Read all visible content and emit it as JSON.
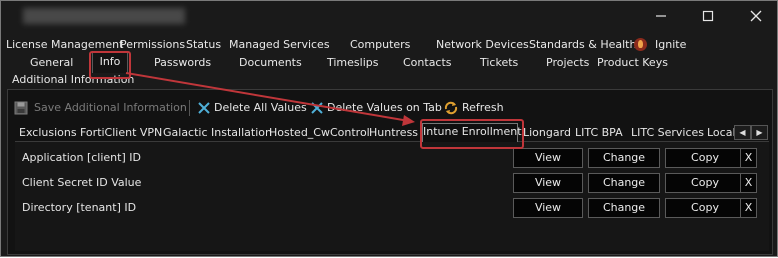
{
  "window": {
    "title": "",
    "minimize_glyph": "minimize-icon",
    "maximize_glyph": "maximize-icon",
    "close_glyph": "close-icon"
  },
  "top_tabs_row1": [
    {
      "label": "License Management"
    },
    {
      "label": "Permissions"
    },
    {
      "label": "Status"
    },
    {
      "label": "Managed Services"
    },
    {
      "label": "Computers"
    },
    {
      "label": "Network Devices"
    },
    {
      "label": "Standards & Health"
    },
    {
      "label": "Ignite"
    }
  ],
  "top_tabs_row2": [
    {
      "label": "General"
    },
    {
      "label": "Info",
      "selected": true
    },
    {
      "label": "Passwords"
    },
    {
      "label": "Documents"
    },
    {
      "label": "Timeslips"
    },
    {
      "label": "Contacts"
    },
    {
      "label": "Tickets"
    },
    {
      "label": "Projects"
    },
    {
      "label": "Product Keys"
    }
  ],
  "section_label": "Additional Information",
  "toolbar": {
    "save_label": "Save Additional Information",
    "delete_all_label": "Delete All Values",
    "delete_tab_label": "Delete Values on Tab",
    "refresh_label": "Refresh"
  },
  "sub_tabs": [
    {
      "label": "Exclusions"
    },
    {
      "label": "FortiClient VPN"
    },
    {
      "label": "Galactic Installation"
    },
    {
      "label": "Hosted_CwControl"
    },
    {
      "label": "Huntress"
    },
    {
      "label": "Intune Enrollment",
      "selected": true
    },
    {
      "label": "Liongard"
    },
    {
      "label": "LITC BPA"
    },
    {
      "label": "LITC Services"
    },
    {
      "label": "Local"
    }
  ],
  "rows": [
    {
      "label": "Application [client] ID",
      "view": "View",
      "change": "Change",
      "copy": "Copy",
      "clear": "X"
    },
    {
      "label": "Client Secret ID Value",
      "view": "View",
      "change": "Change",
      "copy": "Copy",
      "clear": "X"
    },
    {
      "label": "Directory [tenant] ID",
      "view": "View",
      "change": "Change",
      "copy": "Copy",
      "clear": "X"
    }
  ],
  "colors": {
    "background": "#1a1a1a",
    "highlight_annotation": "#c0363a",
    "delete_icon": "#4fb0d8",
    "refresh_icon": "#e0a030"
  }
}
